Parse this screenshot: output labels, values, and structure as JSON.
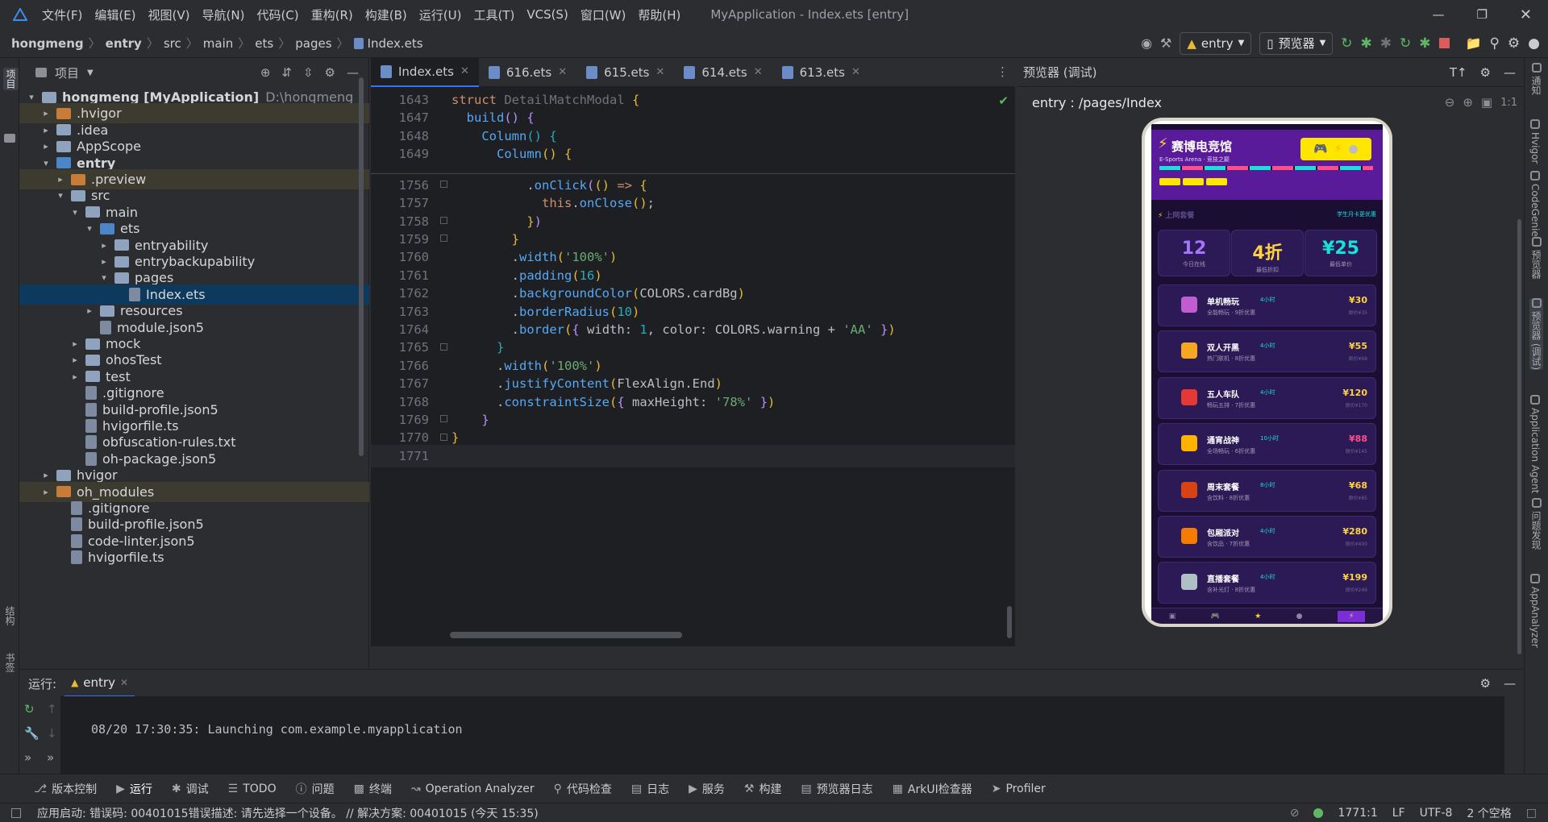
{
  "menubar": {
    "items": [
      "文件(F)",
      "编辑(E)",
      "视图(V)",
      "导航(N)",
      "代码(C)",
      "重构(R)",
      "构建(B)",
      "运行(U)",
      "工具(T)",
      "VCS(S)",
      "窗口(W)",
      "帮助(H)"
    ],
    "title": "MyApplication - Index.ets [entry]"
  },
  "breadcrumb": [
    "hongmeng",
    "entry",
    "src",
    "main",
    "ets",
    "pages",
    "Index.ets"
  ],
  "toolbar": {
    "run_config": "entry",
    "previewer": "预览器"
  },
  "project": {
    "title": "项目",
    "tree": [
      {
        "label": "hongmeng [MyApplication]",
        "extra": "D:\\hongmeng",
        "indent": 0,
        "arrow": "▾",
        "icon": "fold"
      },
      {
        "label": ".hvigor",
        "indent": 1,
        "arrow": "▸",
        "icon": "fold orange"
      },
      {
        "label": ".idea",
        "indent": 1,
        "arrow": "▸",
        "icon": "fold"
      },
      {
        "label": "AppScope",
        "indent": 1,
        "arrow": "▸",
        "icon": "fold"
      },
      {
        "label": "entry",
        "indent": 1,
        "arrow": "▾",
        "icon": "fold blue"
      },
      {
        "label": ".preview",
        "indent": 2,
        "arrow": "▸",
        "icon": "fold orange"
      },
      {
        "label": "src",
        "indent": 2,
        "arrow": "▾",
        "icon": "fold"
      },
      {
        "label": "main",
        "indent": 3,
        "arrow": "▾",
        "icon": "fold"
      },
      {
        "label": "ets",
        "indent": 4,
        "arrow": "▾",
        "icon": "fold blue"
      },
      {
        "label": "entryability",
        "indent": 5,
        "arrow": "▸",
        "icon": "fold"
      },
      {
        "label": "entrybackupability",
        "indent": 5,
        "arrow": "▸",
        "icon": "fold"
      },
      {
        "label": "pages",
        "indent": 5,
        "arrow": "▾",
        "icon": "fold"
      },
      {
        "label": "Index.ets",
        "indent": 6,
        "arrow": "",
        "icon": "file"
      },
      {
        "label": "resources",
        "indent": 4,
        "arrow": "▸",
        "icon": "fold"
      },
      {
        "label": "module.json5",
        "indent": 4,
        "arrow": "",
        "icon": "file"
      },
      {
        "label": "mock",
        "indent": 3,
        "arrow": "▸",
        "icon": "fold"
      },
      {
        "label": "ohosTest",
        "indent": 3,
        "arrow": "▸",
        "icon": "fold"
      },
      {
        "label": "test",
        "indent": 3,
        "arrow": "▸",
        "icon": "fold"
      },
      {
        "label": ".gitignore",
        "indent": 3,
        "arrow": "",
        "icon": "file"
      },
      {
        "label": "build-profile.json5",
        "indent": 3,
        "arrow": "",
        "icon": "file"
      },
      {
        "label": "hvigorfile.ts",
        "indent": 3,
        "arrow": "",
        "icon": "file"
      },
      {
        "label": "obfuscation-rules.txt",
        "indent": 3,
        "arrow": "",
        "icon": "file"
      },
      {
        "label": "oh-package.json5",
        "indent": 3,
        "arrow": "",
        "icon": "file"
      },
      {
        "label": "hvigor",
        "indent": 1,
        "arrow": "▸",
        "icon": "fold"
      },
      {
        "label": "oh_modules",
        "indent": 1,
        "arrow": "▸",
        "icon": "fold orange"
      },
      {
        "label": ".gitignore",
        "indent": 2,
        "arrow": "",
        "icon": "file"
      },
      {
        "label": "build-profile.json5",
        "indent": 2,
        "arrow": "",
        "icon": "file"
      },
      {
        "label": "code-linter.json5",
        "indent": 2,
        "arrow": "",
        "icon": "file"
      },
      {
        "label": "hvigorfile.ts",
        "indent": 2,
        "arrow": "",
        "icon": "file"
      }
    ]
  },
  "editor": {
    "tabs": [
      "Index.ets",
      "616.ets",
      "615.ets",
      "614.ets",
      "613.ets"
    ],
    "sticky": [
      {
        "n": "1643",
        "html": "<span class='kw'>struct</span> <span class='pl' style='color:#6f737a'>DetailMatchModal</span> <span class='yl'>{</span>"
      },
      {
        "n": "1647",
        "html": "  <span class='fn'>build</span><span class='pu'>()</span> <span class='pu'>{</span>"
      },
      {
        "n": "1648",
        "html": "    <span class='fn'>Column</span><span class='ty'>()</span> <span class='ty'>{</span>"
      },
      {
        "n": "1649",
        "html": "      <span class='fn'>Column</span><span class='yl'>()</span> <span class='yl'>{</span>"
      }
    ],
    "lines": [
      {
        "n": "1756",
        "html": "          <span class='pl'>.</span><span class='fn'>onClick</span><span class='pu'>(</span><span class='yl'>()</span> <span class='kw'>=&gt;</span> <span class='yl'>{</span>"
      },
      {
        "n": "1757",
        "html": "            <span class='kw'>this</span><span class='pl'>.</span><span class='fn'>onClose</span><span class='yl'>()</span><span class='pl'>;</span>"
      },
      {
        "n": "1758",
        "html": "          <span class='yl'>}</span><span class='pu'>)</span>"
      },
      {
        "n": "1759",
        "html": "        <span class='yl'>}</span>"
      },
      {
        "n": "1760",
        "html": "        <span class='pl'>.</span><span class='fn'>width</span><span class='yl'>(</span><span class='st'>'100%'</span><span class='yl'>)</span>"
      },
      {
        "n": "1761",
        "html": "        <span class='pl'>.</span><span class='fn'>padding</span><span class='yl'>(</span><span class='nm'>16</span><span class='yl'>)</span>"
      },
      {
        "n": "1762",
        "html": "        <span class='pl'>.</span><span class='fn'>backgroundColor</span><span class='yl'>(</span><span class='pl'>COLORS.cardBg</span><span class='yl'>)</span>"
      },
      {
        "n": "1763",
        "html": "        <span class='pl'>.</span><span class='fn'>borderRadius</span><span class='yl'>(</span><span class='nm'>10</span><span class='yl'>)</span>"
      },
      {
        "n": "1764",
        "html": "        <span class='pl'>.</span><span class='fn'>border</span><span class='yl'>(</span><span class='pu'>{</span> <span class='pl'>width: </span><span class='nm'>1</span><span class='pl'>, color: COLORS.warning + </span><span class='st'>'AA'</span> <span class='pu'>}</span><span class='yl'>)</span>"
      },
      {
        "n": "1765",
        "html": "      <span class='ty'>}</span>"
      },
      {
        "n": "1766",
        "html": "      <span class='pl'>.</span><span class='fn'>width</span><span class='yl'>(</span><span class='st'>'100%'</span><span class='yl'>)</span>"
      },
      {
        "n": "1767",
        "html": "      <span class='pl'>.</span><span class='fn'>justifyContent</span><span class='yl'>(</span><span class='pl'>FlexAlign.End</span><span class='yl'>)</span>"
      },
      {
        "n": "1768",
        "html": "      <span class='pl'>.</span><span class='fn'>constraintSize</span><span class='yl'>(</span><span class='pu'>{</span> <span class='pl'>maxHeight: </span><span class='st'>'78%'</span> <span class='pu'>}</span><span class='yl'>)</span>"
      },
      {
        "n": "1769",
        "html": "    <span class='pu'>}</span>"
      },
      {
        "n": "1770",
        "html": "<span class='yl'>}</span>"
      },
      {
        "n": "1771",
        "html": ""
      }
    ]
  },
  "preview": {
    "title": "预览器 (调试)",
    "path": "entry : /pages/Index",
    "app": {
      "name": "赛博电竞馆",
      "subtitle": "E-Sports Arena · 竞技之巅",
      "section": "上网套餐",
      "section_note": "学生月卡更优惠",
      "stats": [
        {
          "v": "12",
          "l": "今日在线",
          "color": "#a675ff"
        },
        {
          "v": "4折",
          "l": "最低折扣",
          "color": "#ffd23f"
        },
        {
          "v": "¥25",
          "l": "最低单价",
          "color": "#18e1d9"
        }
      ],
      "cards": [
        {
          "t": "单机畅玩",
          "d": "4小时",
          "desc": "全能畅玩 · 9折优惠",
          "p": "¥30",
          "o": "原价¥35",
          "c": "#c25dd1",
          "pink": false
        },
        {
          "t": "双人开黑",
          "d": "4小时",
          "desc": "热门联机 · 8折优惠",
          "p": "¥55",
          "o": "原价¥68",
          "c": "#f5a623",
          "pink": false
        },
        {
          "t": "五人车队",
          "d": "4小时",
          "desc": "畅玩五排 · 7折优惠",
          "p": "¥120",
          "o": "原价¥170",
          "c": "#e53935",
          "pink": false
        },
        {
          "t": "通宵战神",
          "d": "10小时",
          "desc": "全场畅玩 · 6折优惠",
          "p": "¥88",
          "o": "原价¥145",
          "c": "#ffb300",
          "pink": true
        },
        {
          "t": "周末套餐",
          "d": "8小时",
          "desc": "含饮料 · 8折优惠",
          "p": "¥68",
          "o": "原价¥85",
          "c": "#d84315",
          "pink": false
        },
        {
          "t": "包厢派对",
          "d": "4小时",
          "desc": "含饮品 · 7折优惠",
          "p": "¥280",
          "o": "原价¥400",
          "c": "#f57c00",
          "pink": false
        },
        {
          "t": "直播套餐",
          "d": "4小时",
          "desc": "含补光灯 · 8折优惠",
          "p": "¥199",
          "o": "原价¥249",
          "c": "#b0bec5",
          "pink": false
        }
      ]
    }
  },
  "run": {
    "label": "运行:",
    "tab": "entry",
    "output": "08/20 17:30:35: Launching com.example.myapplication"
  },
  "bottom_tools": [
    "版本控制",
    "运行",
    "调试",
    "TODO",
    "问题",
    "终端",
    "Operation Analyzer",
    "代码检查",
    "日志",
    "服务",
    "构建",
    "预览器日志",
    "ArkUI检查器",
    "Profiler"
  ],
  "status": {
    "message": "应用启动: 错误码: 00401015错误描述: 请先选择一个设备。 // 解决方案: 00401015 (今天 15:35)",
    "position": "1771:1",
    "line_sep": "LF",
    "encoding": "UTF-8",
    "indent": "2 个空格"
  },
  "right_strip": [
    "通知",
    "Hvigor",
    "CodeGenie",
    "预览器",
    "预览器 (调试)",
    "Application Agent",
    "问题发现",
    "AppAnalyzer"
  ],
  "left_strip": [
    "项目",
    "结构",
    "书签"
  ]
}
